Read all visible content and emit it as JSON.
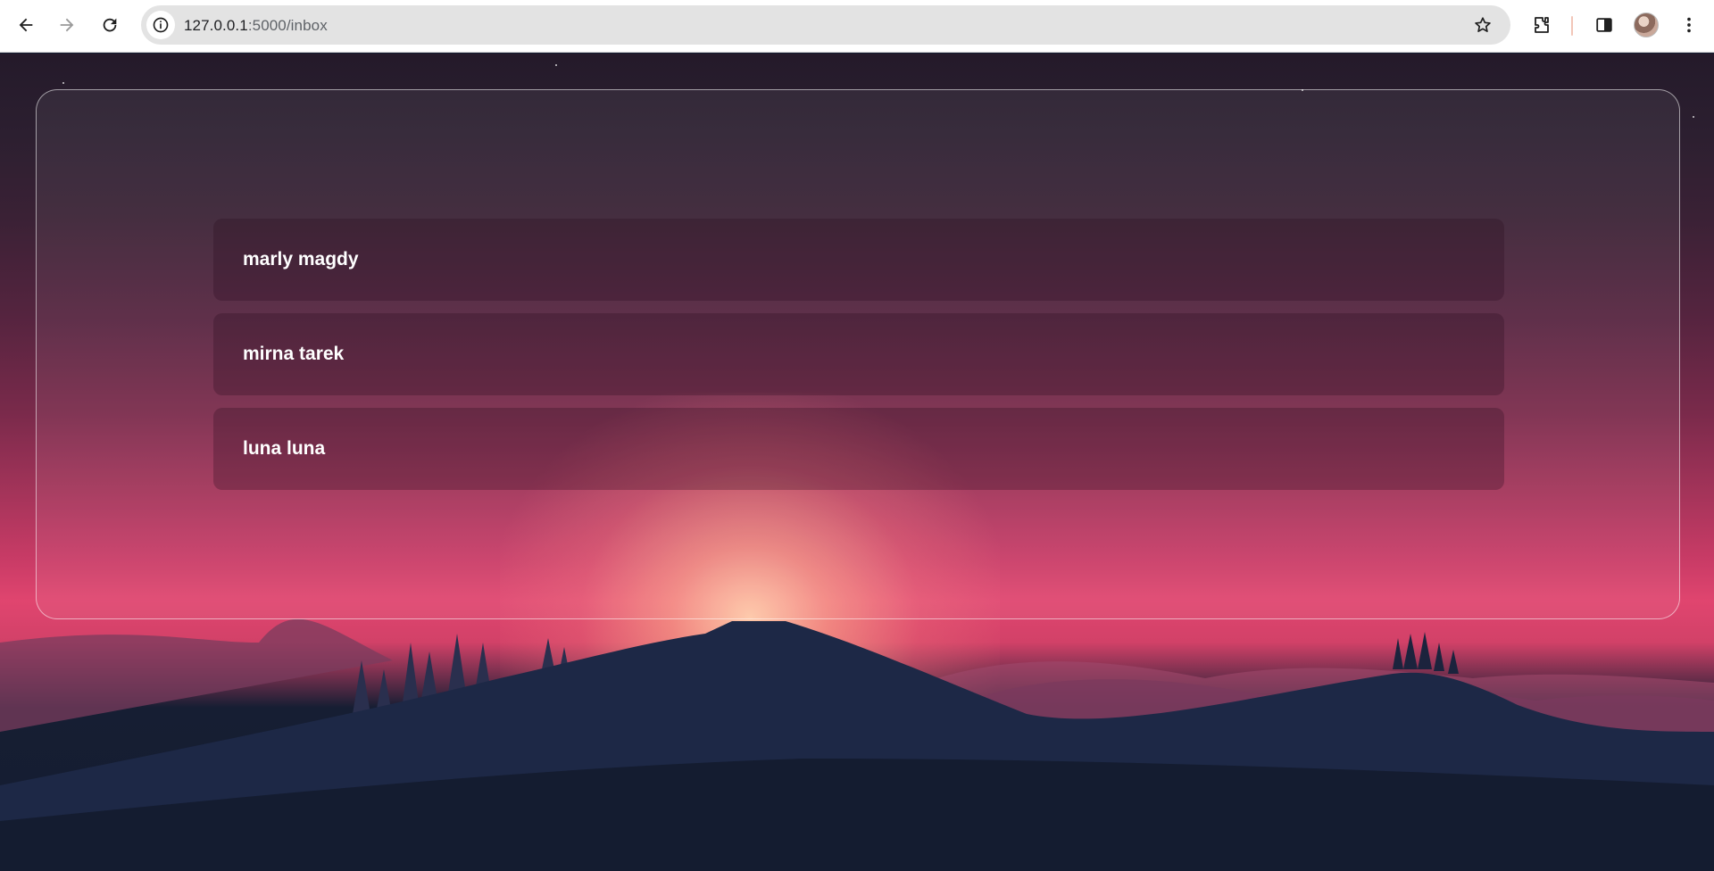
{
  "browser": {
    "url_host": "127.0.0.1",
    "url_path": ":5000/inbox",
    "icons": [
      "back-arrow-icon",
      "forward-arrow-icon",
      "reload-icon",
      "site-info-icon",
      "bookmark-star-icon",
      "extensions-icon",
      "side-panel-icon",
      "profile-avatar",
      "more-menu-icon"
    ]
  },
  "inbox": {
    "conversations": [
      {
        "name": "marly magdy"
      },
      {
        "name": "mirna tarek"
      },
      {
        "name": "luna luna"
      }
    ]
  },
  "colors": {
    "sky_top": "#241a2a",
    "sky_horizon": "#e0456f",
    "sun_glow": "#ffceaa",
    "mountain": "#1e2a4a",
    "ground": "#141c30"
  }
}
